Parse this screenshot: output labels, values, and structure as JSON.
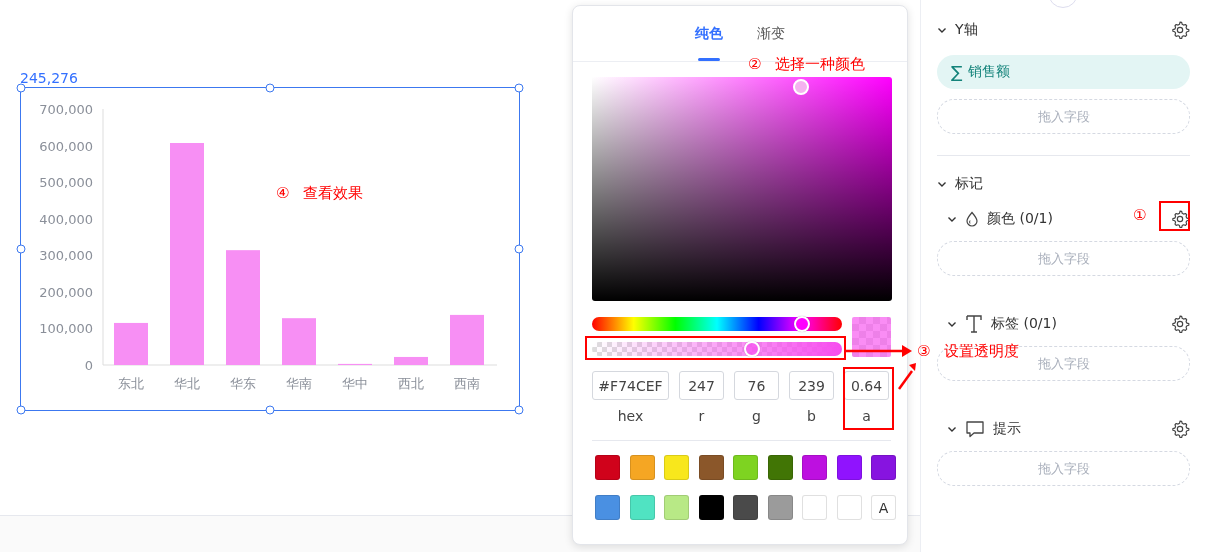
{
  "canvas": {
    "selection_label": "245,276",
    "chart_data": {
      "type": "bar",
      "categories": [
        "东北",
        "华北",
        "华东",
        "华南",
        "华中",
        "西北",
        "西南"
      ],
      "series": [
        {
          "color": "#f78ff4",
          "values": [
            115000,
            607000,
            314000,
            128000,
            3000,
            22000,
            137000
          ]
        }
      ],
      "ylim": [
        0,
        700000
      ],
      "yticks": [
        {
          "value": 0,
          "label": "0"
        },
        {
          "value": 100000,
          "label": "100,000"
        },
        {
          "value": 200000,
          "label": "200,000"
        },
        {
          "value": 300000,
          "label": "300,000"
        },
        {
          "value": 400000,
          "label": "400,000"
        },
        {
          "value": 500000,
          "label": "500,000"
        },
        {
          "value": 600000,
          "label": "600,000"
        },
        {
          "value": 700000,
          "label": "700,000"
        }
      ]
    }
  },
  "color_picker": {
    "tabs": [
      {
        "label": "纯色",
        "selected": true
      },
      {
        "label": "渐变",
        "selected": false
      }
    ],
    "hue": {
      "level": 0.84
    },
    "alpha": {
      "level": 0.64
    },
    "inputs": [
      {
        "label": "hex",
        "value": "#F74CEF"
      },
      {
        "label": "r",
        "value": "247"
      },
      {
        "label": "g",
        "value": "76"
      },
      {
        "label": "b",
        "value": "239"
      },
      {
        "label": "a",
        "value": "0.64"
      }
    ],
    "swatches": [
      {
        "kind": "color",
        "color": "#d0021b"
      },
      {
        "kind": "color",
        "color": "#f5a623"
      },
      {
        "kind": "color",
        "color": "#f8e71c"
      },
      {
        "kind": "color",
        "color": "#8b572a"
      },
      {
        "kind": "color",
        "color": "#7ed321"
      },
      {
        "kind": "color",
        "color": "#417505"
      },
      {
        "kind": "color",
        "color": "#bd10e0"
      },
      {
        "kind": "color",
        "color": "#9013fe"
      },
      {
        "kind": "color",
        "color": "#8714e0"
      },
      {
        "kind": "color",
        "color": "#4a90e2"
      },
      {
        "kind": "color",
        "color": "#50e3c2"
      },
      {
        "kind": "color",
        "color": "#b8e986"
      },
      {
        "kind": "color",
        "color": "#000000"
      },
      {
        "kind": "color",
        "color": "#4a4a4a"
      },
      {
        "kind": "color",
        "color": "#9b9b9b"
      },
      {
        "kind": "color",
        "color": "#ffffff"
      },
      {
        "kind": "transparent"
      },
      {
        "kind": "text",
        "label": "A"
      }
    ]
  },
  "panel": {
    "y_axis": {
      "title": "Y轴",
      "expanded": true,
      "field_icon": "∑",
      "field": "销售额",
      "drop_hint": "拖入字段"
    },
    "marks": {
      "title": "标记",
      "expanded": true,
      "items": [
        {
          "kind": "color",
          "label": "颜色 (0/1)",
          "expanded": true,
          "drop_hint": "拖入字段"
        },
        {
          "kind": "label",
          "label": "标签 (0/1)",
          "expanded": true,
          "drop_hint": "拖入字段"
        },
        {
          "kind": "tooltip",
          "label": "提示",
          "expanded": true,
          "drop_hint": "拖入字段"
        }
      ]
    }
  },
  "annotations": [
    {
      "number": "①"
    },
    {
      "number": "②",
      "text": "选择一种颜色"
    },
    {
      "number": "③",
      "text": "设置透明度"
    },
    {
      "number": "④",
      "text": "查看效果"
    }
  ]
}
